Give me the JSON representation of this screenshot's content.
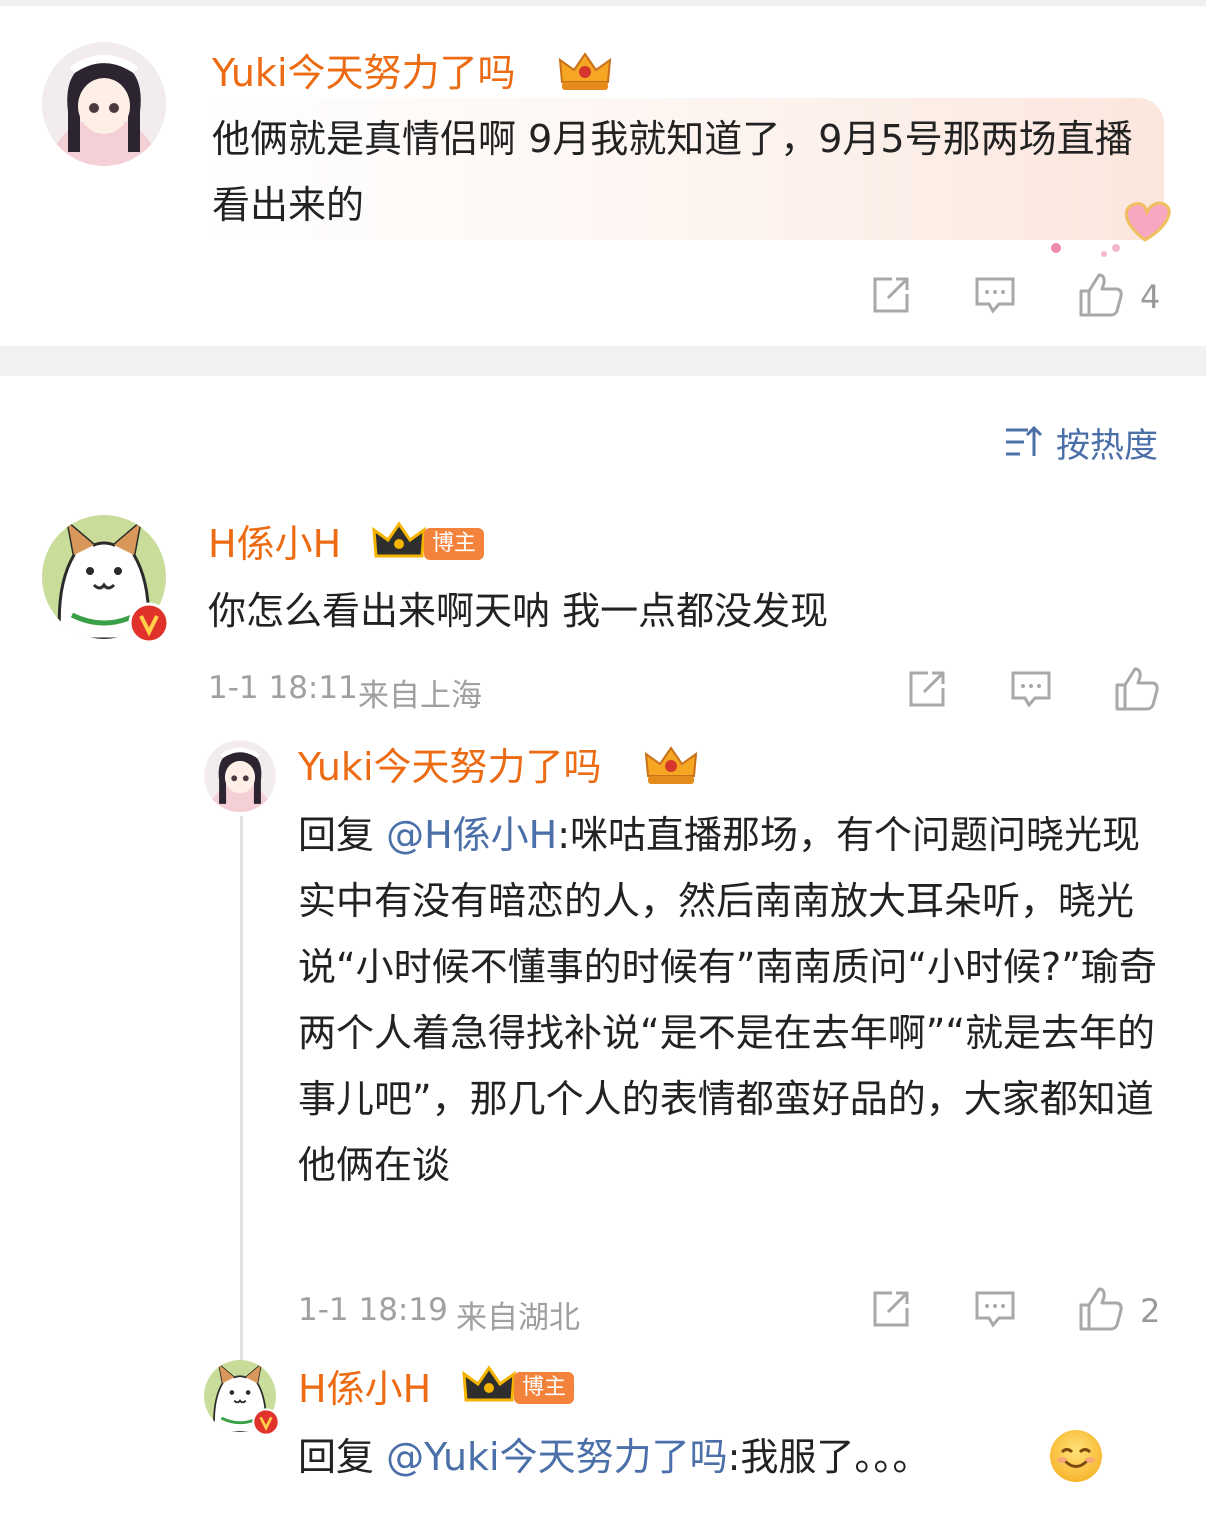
{
  "colors": {
    "username": "#ec6b13",
    "mention": "#4b6fa8",
    "meta": "#a0a0a0",
    "divider": "#f1f1f1",
    "badge_boss": "#f3823a"
  },
  "top_comment": {
    "username": "Yuki今天努力了吗",
    "text": "他俩就是真情侣啊 9月我就知道了，9月5号那两场直播看出来的",
    "like_count": "4",
    "icons": [
      "share-icon",
      "comment-icon",
      "like-icon"
    ]
  },
  "sort": {
    "label": "按热度",
    "icon": "sort-icon"
  },
  "main_comment": {
    "username": "H係小H",
    "badge": "博主",
    "text": "你怎么看出来啊天呐 我一点都没发现",
    "time": "1-1 18:11",
    "location": "来自上海",
    "icons": [
      "share-icon",
      "comment-icon",
      "like-icon"
    ]
  },
  "replies": [
    {
      "username": "Yuki今天努力了吗",
      "reply_prefix": "回复 ",
      "mention": "@H係小H",
      "text": ":咪咕直播那场，有个问题问晓光现实中有没有暗恋的人，然后南南放大耳朵听，晓光说“小时候不懂事的时候有”南南质问“小时候?”瑜奇两个人着急得找补说“是不是在去年啊”“就是去年的事儿吧”，那几个人的表情都蛮好品的，大家都知道他俩在谈",
      "time": "1-1 18:19",
      "location": "来自湖北",
      "like_count": "2"
    },
    {
      "username": "H係小H",
      "badge": "博主",
      "reply_prefix": "回复 ",
      "mention": "@Yuki今天努力了吗",
      "text": ":我服了。。。",
      "emoji": "smile-emoji"
    }
  ]
}
